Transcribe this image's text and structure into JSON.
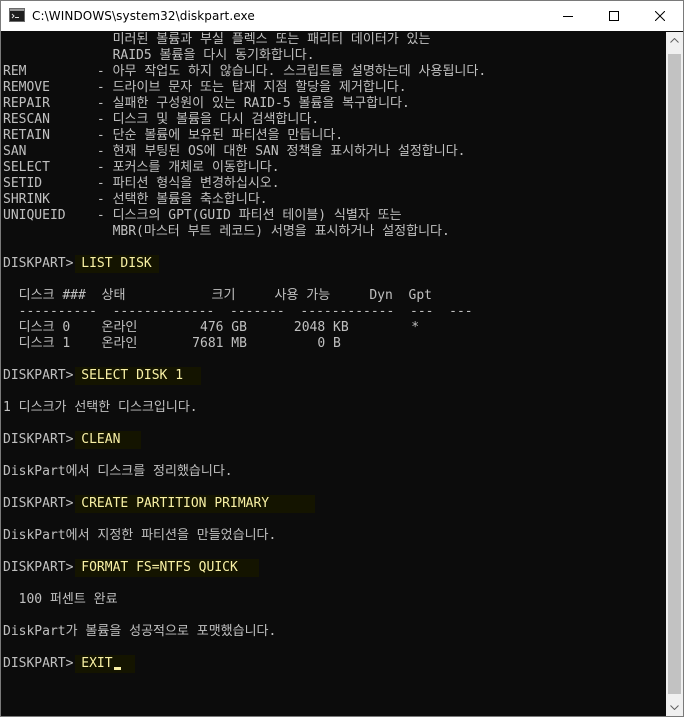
{
  "window": {
    "title": "C:\\WINDOWS\\system32\\diskpart.exe"
  },
  "help_lines": [
    "              미러된 볼륨과 부실 플렉스 또는 패리티 데이터가 있는",
    "              RAID5 볼륨을 다시 동기화합니다.",
    "REM         - 아무 작업도 하지 않습니다. 스크립트를 설명하는데 사용됩니다.",
    "REMOVE      - 드라이브 문자 또는 탑재 지점 할당을 제거합니다.",
    "REPAIR      - 실패한 구성원이 있는 RAID-5 볼륨을 복구합니다.",
    "RESCAN      - 디스크 및 볼륨을 다시 검색합니다.",
    "RETAIN      - 단순 볼륨에 보유된 파티션을 만듭니다.",
    "SAN         - 현재 부팅된 OS에 대한 SAN 정책을 표시하거나 설정합니다.",
    "SELECT      - 포커스를 개체로 이동합니다.",
    "SETID       - 파티션 형식을 변경하십시오.",
    "SHRINK      - 선택한 볼륨을 축소합니다.",
    "UNIQUEID    - 디스크의 GPT(GUID 파티션 테이블) 식별자 또는",
    "              MBR(마스터 부트 레코드) 서명을 표시하거나 설정합니다."
  ],
  "prompt": "DISKPART> ",
  "commands": {
    "list_disk": "LIST DISK",
    "select_disk": "SELECT DISK 1",
    "clean": "CLEAN",
    "create_partition": "CREATE PARTITION PRIMARY",
    "format": "FORMAT FS=NTFS QUICK",
    "exit": "EXIT"
  },
  "disk_table": {
    "header": "  디스크 ###  상태           크기     사용 가능     Dyn  Gpt",
    "separator": "  ----------  -------------  -------  ------------  ---  ---",
    "rows": [
      "  디스크 0    온라인        476 GB      2048 KB        *",
      "  디스크 1    온라인       7681 MB         0 B"
    ]
  },
  "outputs": {
    "select_result": "1 디스크가 선택한 디스크입니다.",
    "clean_result": "DiskPart에서 디스크를 정리했습니다.",
    "create_result": "DiskPart에서 지정한 파티션을 만들었습니다.",
    "format_progress": "  100 퍼센트 완료",
    "format_result": "DiskPart가 볼륨을 성공적으로 포맷했습니다."
  },
  "colors": {
    "console_bg": "#0c0c0c",
    "console_text": "#c0c0c0",
    "command_text": "#f9f1a5",
    "titlebar_bg": "#ffffff"
  }
}
